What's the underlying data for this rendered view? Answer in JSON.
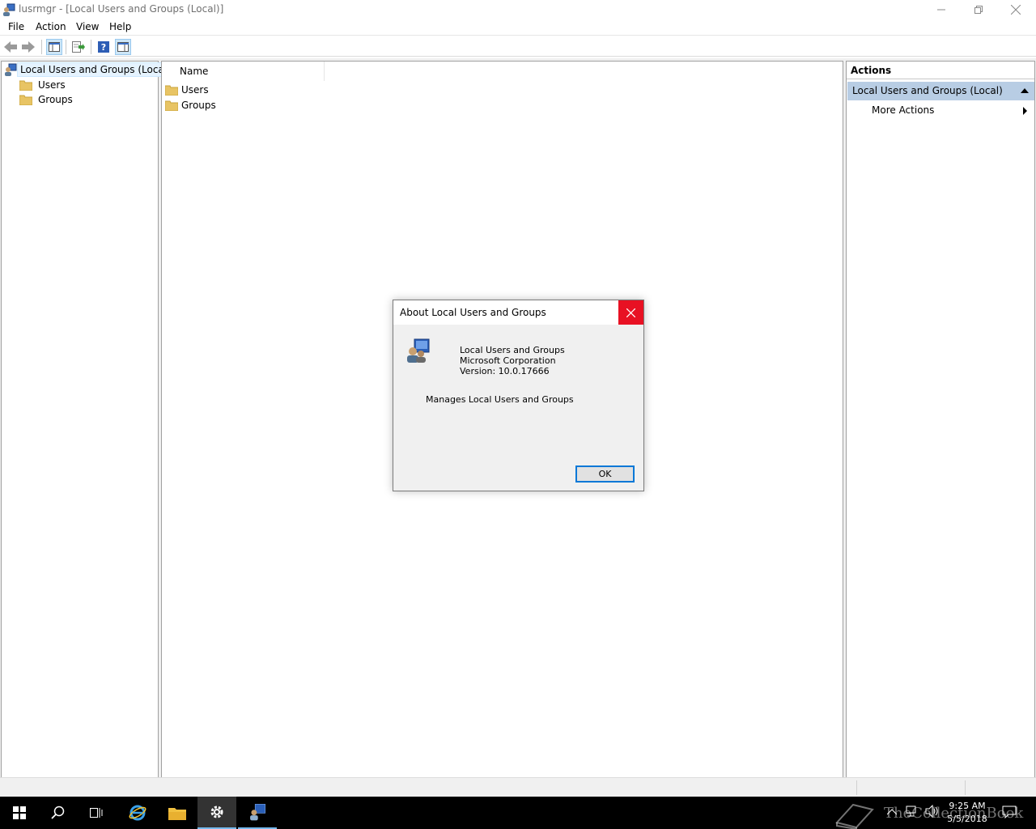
{
  "window": {
    "title": "lusrmgr - [Local Users and Groups (Local)]"
  },
  "menu": [
    "File",
    "Action",
    "View",
    "Help"
  ],
  "tree": {
    "root": "Local Users and Groups (Local)",
    "children": [
      "Users",
      "Groups"
    ]
  },
  "list": {
    "column_name": "Name",
    "rows": [
      "Users",
      "Groups"
    ]
  },
  "actions": {
    "title": "Actions",
    "group": "Local Users and Groups (Local)",
    "more": "More Actions"
  },
  "dialog": {
    "title": "About Local Users and Groups",
    "product": "Local Users and Groups",
    "company": "Microsoft Corporation",
    "version": "Version: 10.0.17666",
    "description": "Manages Local Users and Groups",
    "ok_label": "OK"
  },
  "taskbar": {
    "time": "9:25 AM",
    "date": "5/5/2018"
  },
  "watermark": "TheCollectionBook",
  "colors": {
    "accent": "#0078d7",
    "close_red": "#e81123",
    "action_group_bg": "#b8cde4"
  }
}
